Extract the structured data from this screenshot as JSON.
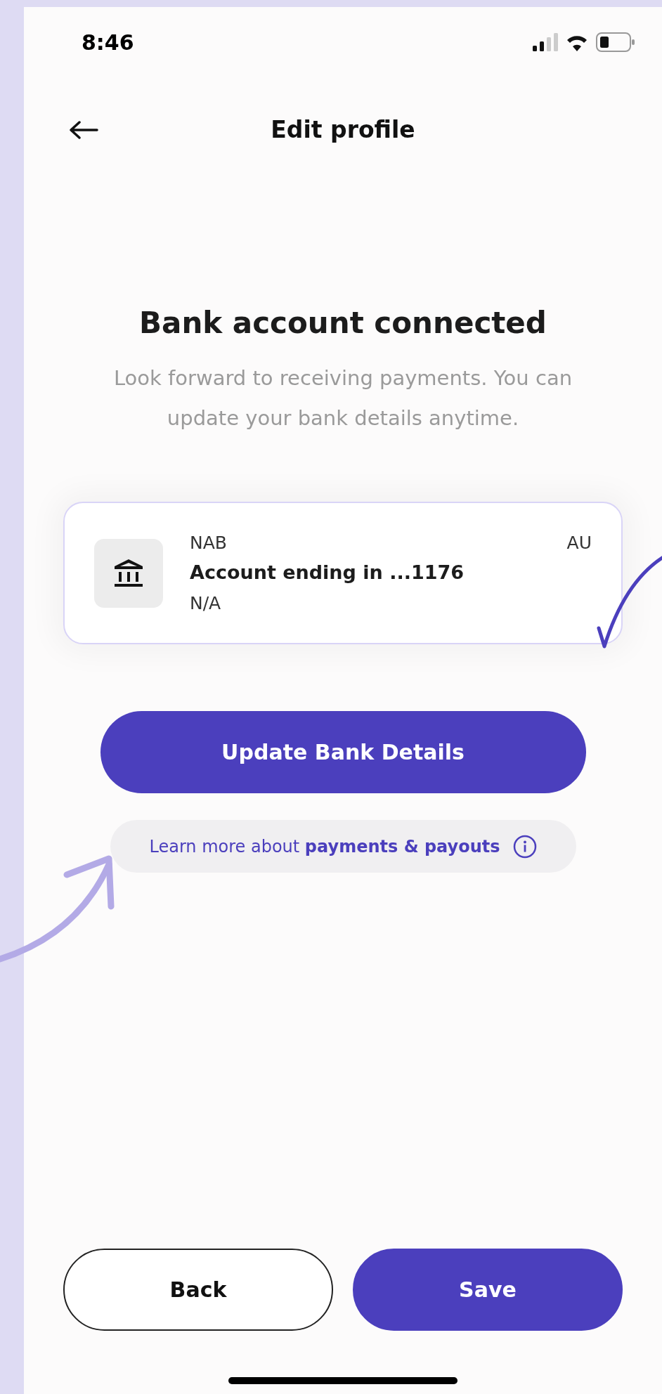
{
  "status_bar": {
    "time": "8:46"
  },
  "header": {
    "title": "Edit profile"
  },
  "heading": "Bank account connected",
  "subtitle": "Look forward to receiving payments. You can update your bank details anytime.",
  "account_card": {
    "bank": "NAB",
    "country": "AU",
    "account": "Account ending in ...1176",
    "detail": "N/A"
  },
  "update_button": "Update Bank Details",
  "learn_more": "Learn more about **payments & payouts**",
  "footer_buttons": [
    {
      "label": "Back",
      "kind": "outline"
    },
    {
      "label": "Save",
      "kind": "filled"
    }
  ]
}
